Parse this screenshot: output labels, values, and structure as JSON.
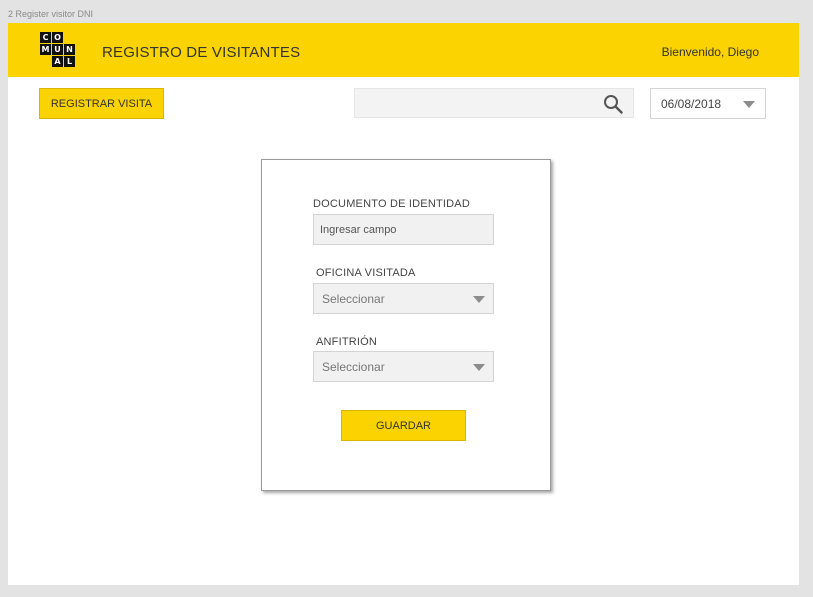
{
  "frame": {
    "label": "2 Register visitor DNI"
  },
  "header": {
    "logo_letters": [
      "CO",
      "MUN",
      "AL"
    ],
    "title": "REGISTRO DE VISITANTES",
    "welcome": "Bienvenido, Diego",
    "background_color": "#fbd300"
  },
  "toolbar": {
    "register_label": "REGISTRAR VISITA",
    "search_value": "",
    "search_icon": "search-icon",
    "date_value": "06/08/2018"
  },
  "form": {
    "document_label": "DOCUMENTO DE IDENTIDAD",
    "document_placeholder": "Ingresar campo",
    "office_label": "OFICINA VISITADA",
    "office_value": "Seleccionar",
    "host_label": "ANFITRIÓN",
    "host_value": "Seleccionar",
    "save_label": "GUARDAR"
  }
}
